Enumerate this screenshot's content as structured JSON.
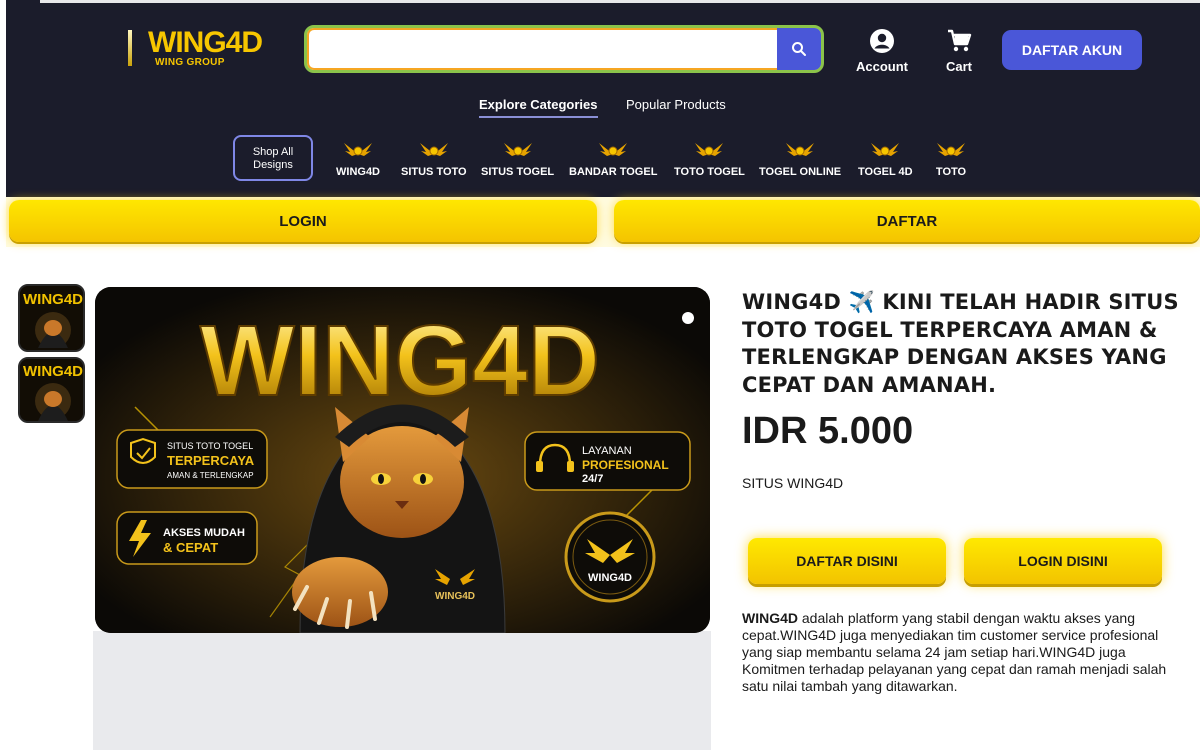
{
  "header": {
    "logo_text": "WING4D",
    "logo_sub": "WING GROUP",
    "search_value": "",
    "account_label": "Account",
    "cart_label": "Cart",
    "daftar_akun_label": "DAFTAR AKUN",
    "tabs": [
      {
        "label": "Explore Categories"
      },
      {
        "label": "Popular Products"
      }
    ],
    "shop_all_label": "Shop All Designs",
    "categories": [
      {
        "label": "WING4D"
      },
      {
        "label": "SITUS TOTO"
      },
      {
        "label": "SITUS TOGEL"
      },
      {
        "label": "BANDAR TOGEL"
      },
      {
        "label": "TOTO TOGEL"
      },
      {
        "label": "TOGEL ONLINE"
      },
      {
        "label": "TOGEL 4D"
      },
      {
        "label": "TOTO"
      }
    ]
  },
  "action_bar": {
    "login_label": "LOGIN",
    "daftar_label": "DAFTAR"
  },
  "hero": {
    "brand": "WING4D",
    "badge1_line1": "SITUS TOTO TOGEL",
    "badge1_line2": "TERPERCAYA",
    "badge1_line3": "AMAN & TERLENGKAP",
    "badge2_line1": "AKSES MUDAH",
    "badge2_line2": "& CEPAT",
    "badge3_line1": "LAYANAN",
    "badge3_line2": "PROFESIONAL",
    "badge3_line3": "24/7",
    "emblem_text": "WING4D",
    "hoodie_text": "WING4D"
  },
  "product": {
    "title": "WING4D ✈️ KINI TELAH HADIR SITUS TOTO TOGEL TERPERCAYA AMAN & TERLENGKAP DENGAN AKSES YANG CEPAT DAN AMANAH.",
    "price": "IDR 5.000",
    "subtitle": "SITUS WING4D",
    "daftar_btn": "DAFTAR DISINI",
    "login_btn": "LOGIN DISINI",
    "desc_brand": "WING4D",
    "desc_text": " adalah platform yang stabil dengan waktu akses yang cepat.WING4D juga menyediakan tim customer service profesional yang siap membantu selama 24 jam setiap hari.WING4D juga Komitmen terhadap pelayanan yang cepat dan ramah menjadi salah satu nilai tambah yang ditawarkan."
  },
  "colors": {
    "header_bg": "#1b1c2b",
    "accent_blue": "#4a57d8",
    "gold": "#f7c600",
    "button_yellow": "#ffe700"
  }
}
